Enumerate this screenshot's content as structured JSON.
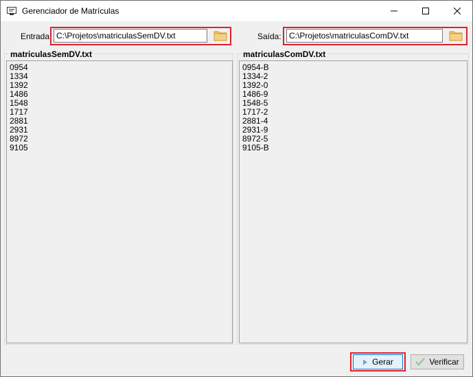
{
  "window": {
    "title": "Gerenciador de Matrículas",
    "title_icon": "window-app-icon",
    "controls": [
      "minimize-icon",
      "maximize-icon",
      "close-icon"
    ]
  },
  "input": {
    "label": "Entrada:",
    "value": "C:\\Projetos\\matriculasSemDV.txt",
    "browse_icon": "folder-icon"
  },
  "output": {
    "label": "Saída:",
    "value": "C:\\Projetos\\matriculasComDV.txt",
    "browse_icon": "folder-icon"
  },
  "left_panel": {
    "title": "matriculasSemDV.txt",
    "items": [
      "0954",
      "1334",
      "1392",
      "1486",
      "1548",
      "1717",
      "2881",
      "2931",
      "8972",
      "9105"
    ]
  },
  "right_panel": {
    "title": "matriculasComDV.txt",
    "items": [
      "0954-B",
      "1334-2",
      "1392-0",
      "1486-9",
      "1548-5",
      "1717-2",
      "2881-4",
      "2931-9",
      "8972-5",
      "9105-B"
    ]
  },
  "buttons": {
    "generate": {
      "label": "Gerar",
      "icon": "play-icon"
    },
    "verify": {
      "label": "Verificar",
      "icon": "check-icon"
    }
  },
  "colors": {
    "highlight": "#e0202a",
    "folder": "#f0c050",
    "focus": "#0078d7"
  }
}
